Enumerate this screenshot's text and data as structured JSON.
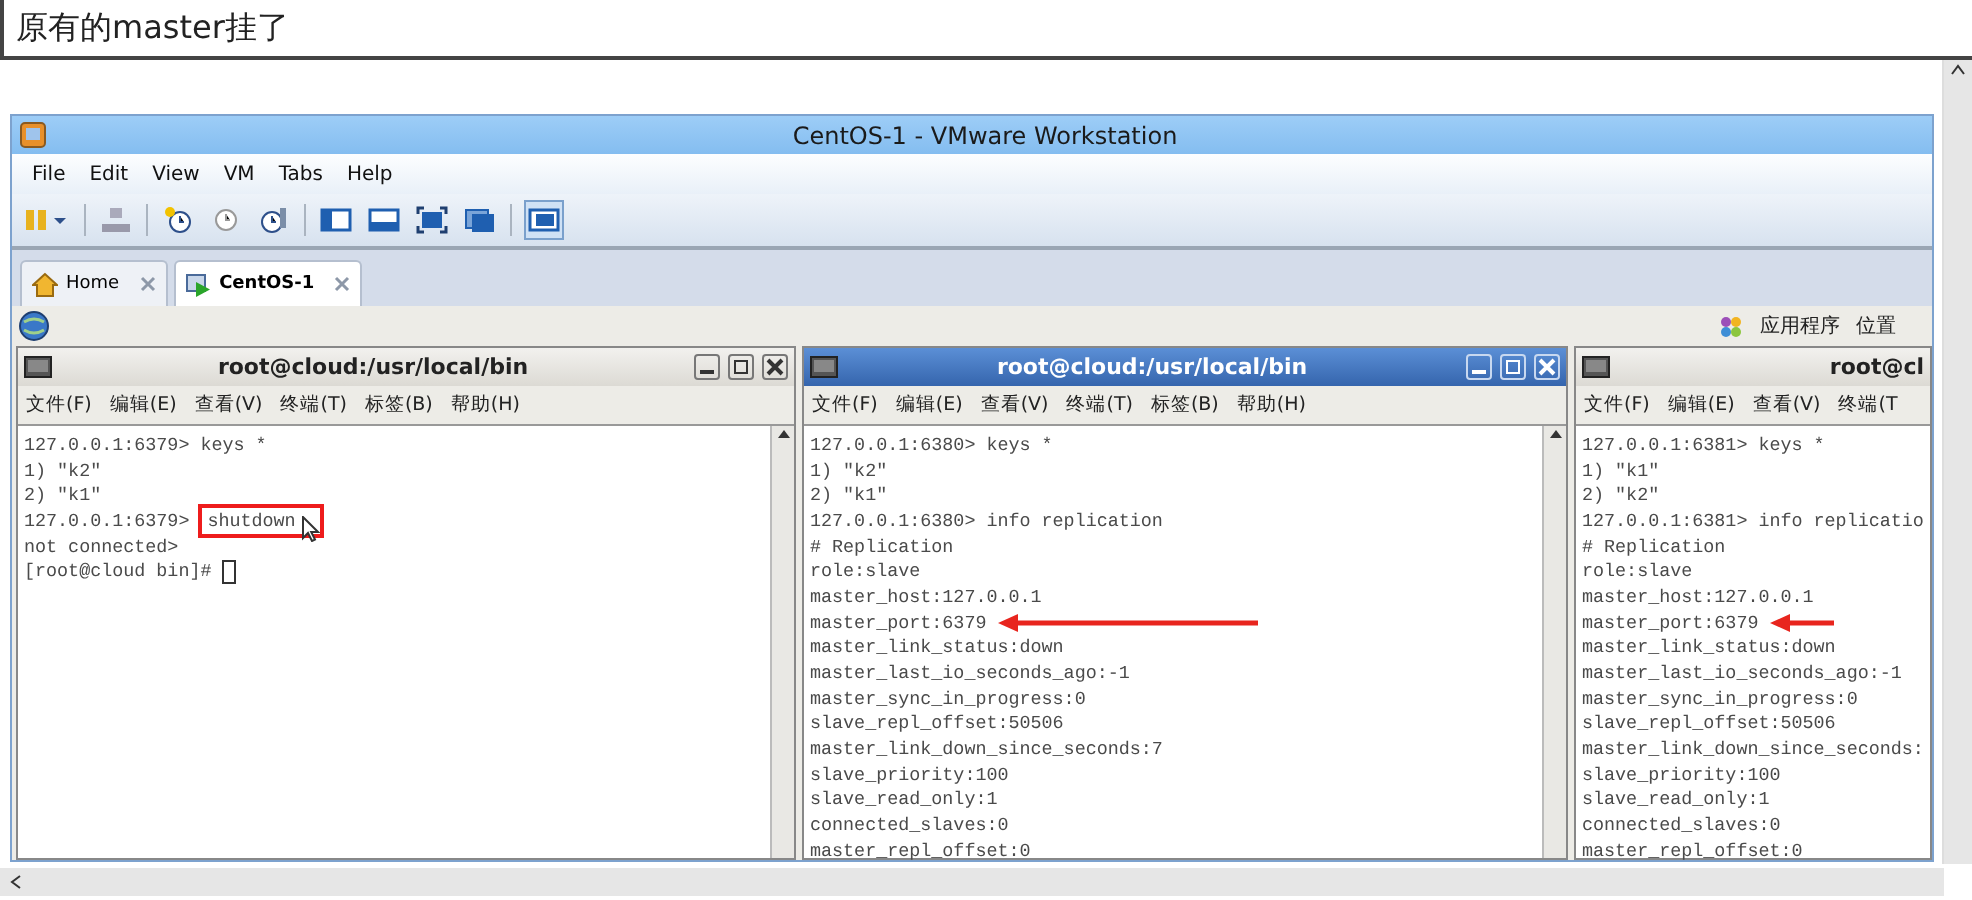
{
  "header": {
    "title": "原有的master挂了"
  },
  "window": {
    "title": "CentOS-1 - VMware Workstation",
    "menu": [
      "File",
      "Edit",
      "View",
      "VM",
      "Tabs",
      "Help"
    ],
    "tabs": [
      {
        "label": "Home",
        "selected": false
      },
      {
        "label": "CentOS-1",
        "selected": true
      }
    ],
    "guest_panel": {
      "items": [
        "应用程序",
        "位置"
      ]
    },
    "terminals": [
      {
        "title": "root@cloud:/usr/local/bin",
        "active": false,
        "menu": [
          "文件(F)",
          "编辑(E)",
          "查看(V)",
          "终端(T)",
          "标签(B)",
          "帮助(H)"
        ],
        "lines": [
          {
            "text": "127.0.0.1:6379> keys *"
          },
          {
            "text": "1) \"k2\""
          },
          {
            "text": "2) \"k1\""
          },
          {
            "text": "127.0.0.1:6379>",
            "boxed": "shutdown"
          },
          {
            "text": "not connected>"
          },
          {
            "text": "[root@cloud bin]#",
            "cursor": true
          }
        ]
      },
      {
        "title": "root@cloud:/usr/local/bin",
        "active": true,
        "menu": [
          "文件(F)",
          "编辑(E)",
          "查看(V)",
          "终端(T)",
          "标签(B)",
          "帮助(H)"
        ],
        "lines": [
          {
            "text": "127.0.0.1:6380> keys *"
          },
          {
            "text": "1) \"k2\""
          },
          {
            "text": "2) \"k1\""
          },
          {
            "text": "127.0.0.1:6380> info replication"
          },
          {
            "text": "# Replication"
          },
          {
            "text": "role:slave"
          },
          {
            "text": "master_host:127.0.0.1"
          },
          {
            "text": "master_port:6379",
            "arrow": true
          },
          {
            "text": "master_link_status:down"
          },
          {
            "text": "master_last_io_seconds_ago:-1"
          },
          {
            "text": "master_sync_in_progress:0"
          },
          {
            "text": "slave_repl_offset:50506"
          },
          {
            "text": "master_link_down_since_seconds:7"
          },
          {
            "text": "slave_priority:100"
          },
          {
            "text": "slave_read_only:1"
          },
          {
            "text": "connected_slaves:0"
          },
          {
            "text": "master_repl_offset:0"
          }
        ]
      },
      {
        "title": "root@cl",
        "active": false,
        "menu": [
          "文件(F)",
          "编辑(E)",
          "查看(V)",
          "终端(T"
        ],
        "lines": [
          {
            "text": "127.0.0.1:6381> keys *"
          },
          {
            "text": "1) \"k1\""
          },
          {
            "text": "2) \"k2\""
          },
          {
            "text": "127.0.0.1:6381> info replicatio"
          },
          {
            "text": "# Replication"
          },
          {
            "text": "role:slave"
          },
          {
            "text": "master_host:127.0.0.1"
          },
          {
            "text": "master_port:6379",
            "arrow": true
          },
          {
            "text": "master_link_status:down"
          },
          {
            "text": "master_last_io_seconds_ago:-1"
          },
          {
            "text": "master_sync_in_progress:0"
          },
          {
            "text": "slave_repl_offset:50506"
          },
          {
            "text": "master_link_down_since_seconds:"
          },
          {
            "text": "slave_priority:100"
          },
          {
            "text": "slave_read_only:1"
          },
          {
            "text": "connected_slaves:0"
          },
          {
            "text": "master_repl_offset:0"
          }
        ]
      }
    ]
  }
}
